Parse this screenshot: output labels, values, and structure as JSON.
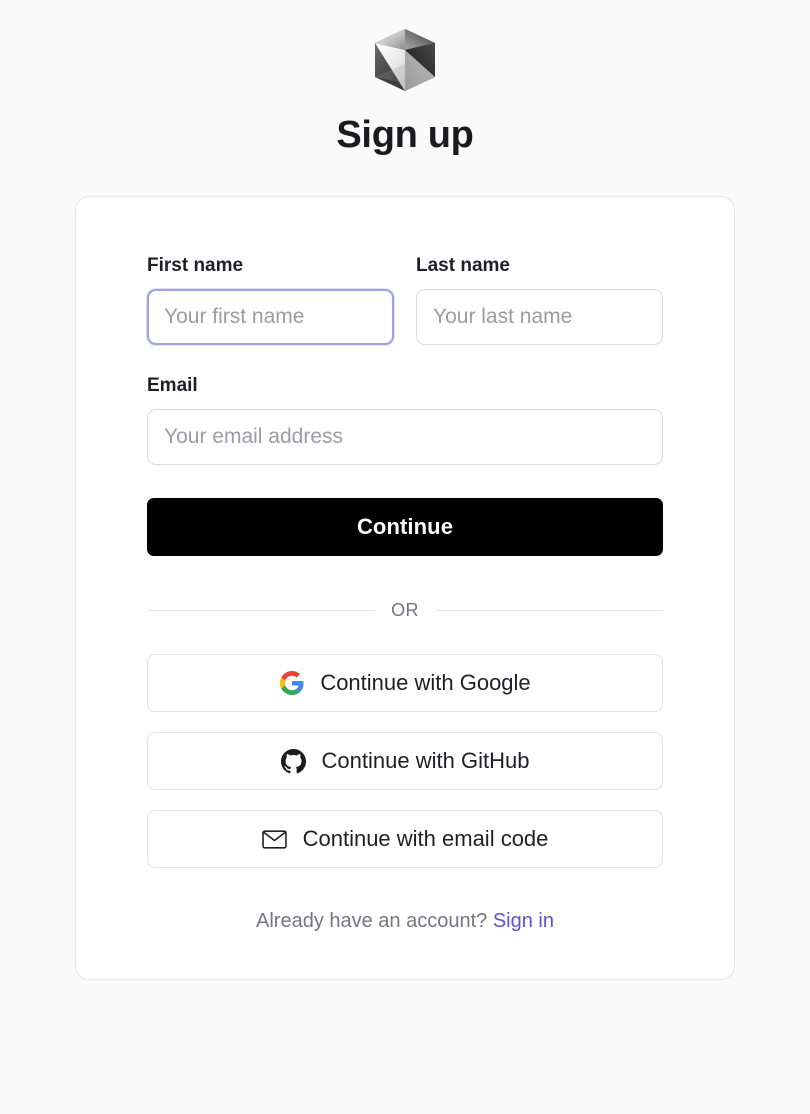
{
  "page": {
    "background_color": "#fafafa",
    "title": "Sign up",
    "logo_icon": "cube-logo-icon"
  },
  "form": {
    "fields": [
      {
        "name": "first_name",
        "label": "First name",
        "placeholder": "Your first name",
        "value": "",
        "focused": true
      },
      {
        "name": "last_name",
        "label": "Last name",
        "placeholder": "Your last name",
        "value": "",
        "focused": false
      },
      {
        "name": "email",
        "label": "Email",
        "placeholder": "Your email address",
        "value": "",
        "focused": false
      }
    ],
    "submit_label": "Continue",
    "submit_bg_color": "#000000",
    "submit_text_color": "#ffffff",
    "focus_ring_color": "#a0a1e3"
  },
  "divider": {
    "label": "OR"
  },
  "social": {
    "buttons": [
      {
        "label": "Continue with Google",
        "icon": "google-g-icon"
      },
      {
        "label": "Continue with GitHub",
        "icon": "github-mark-icon"
      },
      {
        "label": "Continue with email code",
        "icon": "envelope-icon"
      }
    ]
  },
  "footer": {
    "prompt": "Already have an account?",
    "link_label": "Sign in",
    "link_color": "#5d52d4"
  }
}
